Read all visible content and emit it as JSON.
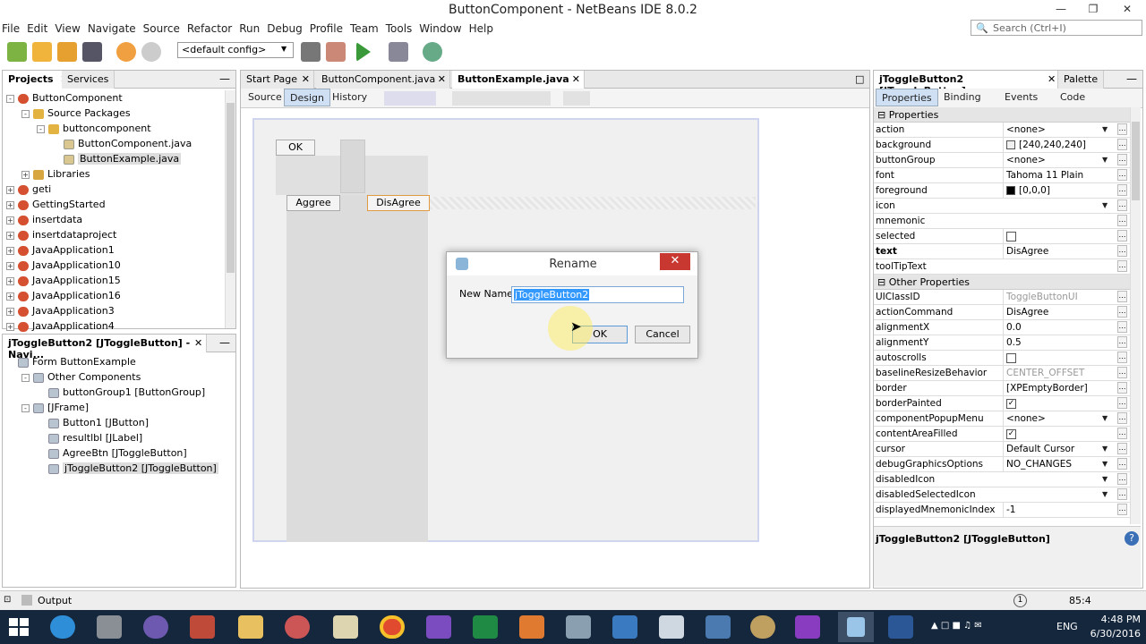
{
  "window": {
    "title": "ButtonComponent - NetBeans IDE 8.0.2"
  },
  "menu": [
    "File",
    "Edit",
    "View",
    "Navigate",
    "Source",
    "Refactor",
    "Run",
    "Debug",
    "Profile",
    "Team",
    "Tools",
    "Window",
    "Help"
  ],
  "search": {
    "placeholder": "Search (Ctrl+I)"
  },
  "toolbar": {
    "config": "<default config>"
  },
  "projects_panel": {
    "tabs": [
      "Projects",
      "Services"
    ],
    "tree": [
      {
        "label": "ButtonComponent",
        "type": "proj",
        "level": 0,
        "exp": "-"
      },
      {
        "label": "Source Packages",
        "type": "pkg",
        "level": 1,
        "exp": "-"
      },
      {
        "label": "buttoncomponent",
        "type": "pkg",
        "level": 2,
        "exp": "-"
      },
      {
        "label": "ButtonComponent.java",
        "type": "java",
        "level": 3,
        "exp": ""
      },
      {
        "label": "ButtonExample.java",
        "type": "java",
        "level": 3,
        "exp": "",
        "selected": true
      },
      {
        "label": "Libraries",
        "type": "folder",
        "level": 1,
        "exp": "+"
      },
      {
        "label": "geti",
        "type": "proj",
        "level": 0,
        "exp": "+"
      },
      {
        "label": "GettingStarted",
        "type": "proj",
        "level": 0,
        "exp": "+"
      },
      {
        "label": "insertdata",
        "type": "proj",
        "level": 0,
        "exp": "+"
      },
      {
        "label": "insertdataproject",
        "type": "proj",
        "level": 0,
        "exp": "+"
      },
      {
        "label": "JavaApplication1",
        "type": "proj",
        "level": 0,
        "exp": "+"
      },
      {
        "label": "JavaApplication10",
        "type": "proj",
        "level": 0,
        "exp": "+"
      },
      {
        "label": "JavaApplication15",
        "type": "proj",
        "level": 0,
        "exp": "+"
      },
      {
        "label": "JavaApplication16",
        "type": "proj",
        "level": 0,
        "exp": "+"
      },
      {
        "label": "JavaApplication3",
        "type": "proj",
        "level": 0,
        "exp": "+"
      },
      {
        "label": "JavaApplication4",
        "type": "proj",
        "level": 0,
        "exp": "+"
      }
    ]
  },
  "navigator": {
    "title": "jToggleButton2 [JToggleButton] - Navi...",
    "tree": [
      {
        "label": "Form ButtonExample",
        "level": 0,
        "exp": ""
      },
      {
        "label": "Other Components",
        "level": 1,
        "exp": "-"
      },
      {
        "label": "buttonGroup1 [ButtonGroup]",
        "level": 2,
        "exp": ""
      },
      {
        "label": "[JFrame]",
        "level": 1,
        "exp": "-"
      },
      {
        "label": "Button1 [JButton]",
        "level": 2,
        "exp": ""
      },
      {
        "label": "resultlbl [JLabel]",
        "level": 2,
        "exp": ""
      },
      {
        "label": "AgreeBtn [JToggleButton]",
        "level": 2,
        "exp": ""
      },
      {
        "label": "jToggleButton2 [JToggleButton]",
        "level": 2,
        "exp": "",
        "selected": true
      }
    ]
  },
  "editor": {
    "tabs": [
      "Start Page",
      "ButtonComponent.java",
      "ButtonExample.java"
    ],
    "active_tab": 2,
    "subtabs": [
      "Source",
      "Design",
      "History"
    ],
    "form": {
      "ok_label": "OK",
      "agree_label": "Aggree",
      "disagree_label": "DisAgree"
    }
  },
  "dialog": {
    "title": "Rename",
    "label": "New Name:",
    "value": "jToggleButton2",
    "ok": "OK",
    "cancel": "Cancel",
    "close": "✕"
  },
  "properties": {
    "title": "jToggleButton2 [JToggleButton] - ...",
    "palette_tab": "Palette",
    "subtabs": [
      "Properties",
      "Binding",
      "Events",
      "Code"
    ],
    "section1": "Properties",
    "rows1": [
      {
        "name": "action",
        "value": "<none>",
        "dd": true
      },
      {
        "name": "background",
        "value": "[240,240,240]",
        "swatch": "#f0f0f0"
      },
      {
        "name": "buttonGroup",
        "value": "<none>",
        "dd": true
      },
      {
        "name": "font",
        "value": "Tahoma 11 Plain"
      },
      {
        "name": "foreground",
        "value": "[0,0,0]",
        "swatch": "#000000"
      },
      {
        "name": "icon",
        "value": "",
        "dd": true
      },
      {
        "name": "mnemonic",
        "value": ""
      },
      {
        "name": "selected",
        "value": "",
        "check": "off"
      },
      {
        "name": "text",
        "value": "DisAgree",
        "bold": true
      },
      {
        "name": "toolTipText",
        "value": ""
      }
    ],
    "section2": "Other Properties",
    "rows2": [
      {
        "name": "UIClassID",
        "value": "ToggleButtonUI",
        "grey": true
      },
      {
        "name": "actionCommand",
        "value": "DisAgree"
      },
      {
        "name": "alignmentX",
        "value": "0.0"
      },
      {
        "name": "alignmentY",
        "value": "0.5"
      },
      {
        "name": "autoscrolls",
        "value": "",
        "check": "off"
      },
      {
        "name": "baselineResizeBehavior",
        "value": "CENTER_OFFSET",
        "grey": true
      },
      {
        "name": "border",
        "value": "[XPEmptyBorder]"
      },
      {
        "name": "borderPainted",
        "value": "",
        "check": "on"
      },
      {
        "name": "componentPopupMenu",
        "value": "<none>",
        "dd": true
      },
      {
        "name": "contentAreaFilled",
        "value": "",
        "check": "on"
      },
      {
        "name": "cursor",
        "value": "Default Cursor",
        "dd": true
      },
      {
        "name": "debugGraphicsOptions",
        "value": "NO_CHANGES",
        "dd": true
      },
      {
        "name": "disabledIcon",
        "value": "",
        "dd": true
      },
      {
        "name": "disabledSelectedIcon",
        "value": "",
        "dd": true
      },
      {
        "name": "displayedMnemonicIndex",
        "value": "-1"
      }
    ],
    "footer": "jToggleButton2 [JToggleButton]"
  },
  "status": {
    "output": "Output",
    "position": "85:4"
  },
  "taskbar": {
    "time": "4:48 PM",
    "date": "6/30/2016",
    "lang": "ENG"
  }
}
